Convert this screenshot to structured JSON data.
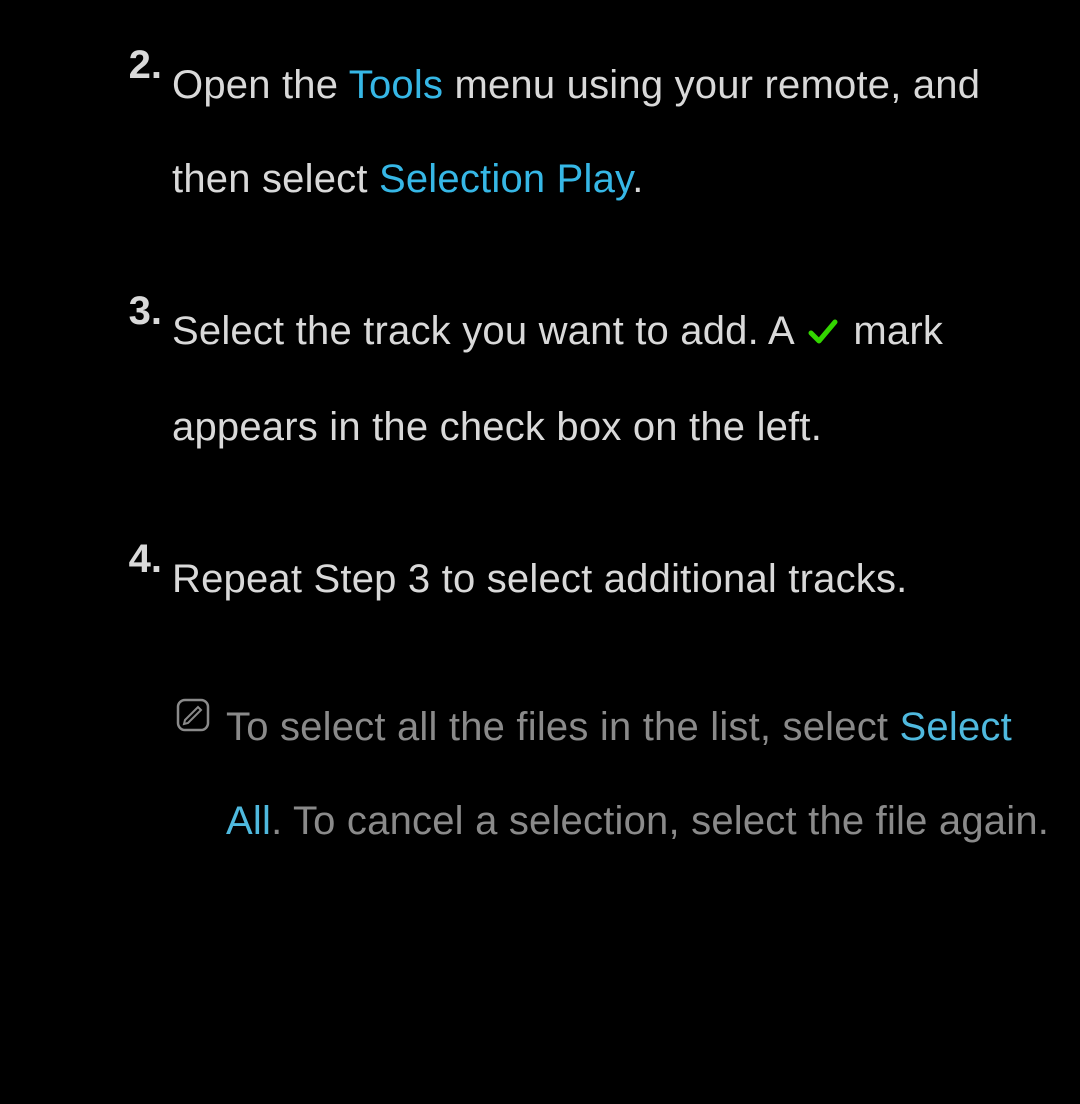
{
  "steps": [
    {
      "num": "2.",
      "t1": "Open the ",
      "hl": "Tools",
      "t2": " menu using your remote, and then select ",
      "hl2": "Selection Play",
      "t3": "."
    },
    {
      "num": "3.",
      "t1": "Select the track you want to add. A ",
      "t2": " mark appears in the check box on the left."
    },
    {
      "num": "4.",
      "t1": "Repeat Step 3 to select additional tracks."
    }
  ],
  "note": {
    "t1": "To select all the files in the list, select ",
    "hl": "Select All",
    "t2": ". To cancel a selection, select the file again."
  }
}
